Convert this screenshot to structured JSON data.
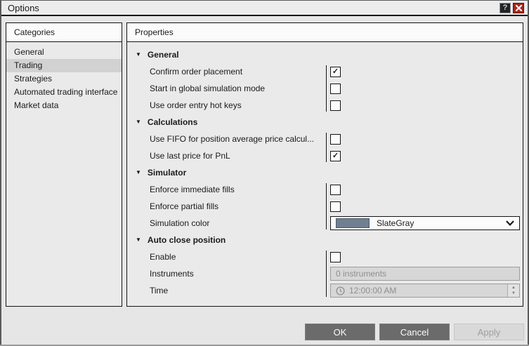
{
  "window": {
    "title": "Options",
    "help_label": "?"
  },
  "icons": {
    "section_collapse": "▼",
    "spinner_up": "▲",
    "spinner_down": "▼",
    "checkbox_check": "✓"
  },
  "categories": {
    "header": "Categories",
    "items": [
      {
        "label": "General",
        "selected": false
      },
      {
        "label": "Trading",
        "selected": true
      },
      {
        "label": "Strategies",
        "selected": false
      },
      {
        "label": "Automated trading interface",
        "selected": false
      },
      {
        "label": "Market data",
        "selected": false
      }
    ]
  },
  "properties": {
    "header": "Properties",
    "sections": [
      {
        "title": "General",
        "rows": [
          {
            "label": "Confirm order placement",
            "control": "checkbox",
            "checked": true
          },
          {
            "label": "Start in global simulation mode",
            "control": "checkbox",
            "checked": false
          },
          {
            "label": "Use order entry hot keys",
            "control": "checkbox",
            "checked": false
          }
        ]
      },
      {
        "title": "Calculations",
        "rows": [
          {
            "label": "Use FIFO for position average price calcul...",
            "control": "checkbox",
            "checked": false
          },
          {
            "label": "Use last price for PnL",
            "control": "checkbox",
            "checked": true
          }
        ]
      },
      {
        "title": "Simulator",
        "rows": [
          {
            "label": "Enforce immediate fills",
            "control": "checkbox",
            "checked": false
          },
          {
            "label": "Enforce partial fills",
            "control": "checkbox",
            "checked": false
          },
          {
            "label": "Simulation color",
            "control": "color-dropdown",
            "value": "SlateGray",
            "swatch": "#708090"
          }
        ]
      },
      {
        "title": "Auto close position",
        "rows": [
          {
            "label": "Enable",
            "control": "checkbox",
            "checked": false
          },
          {
            "label": "Instruments",
            "control": "text-disabled",
            "value": "0 instruments"
          },
          {
            "label": "Time",
            "control": "time-disabled",
            "value": "12:00:00 AM"
          }
        ]
      }
    ]
  },
  "footer": {
    "buttons": [
      {
        "label": "OK",
        "enabled": true
      },
      {
        "label": "Cancel",
        "enabled": true
      },
      {
        "label": "Apply",
        "enabled": false
      }
    ]
  }
}
